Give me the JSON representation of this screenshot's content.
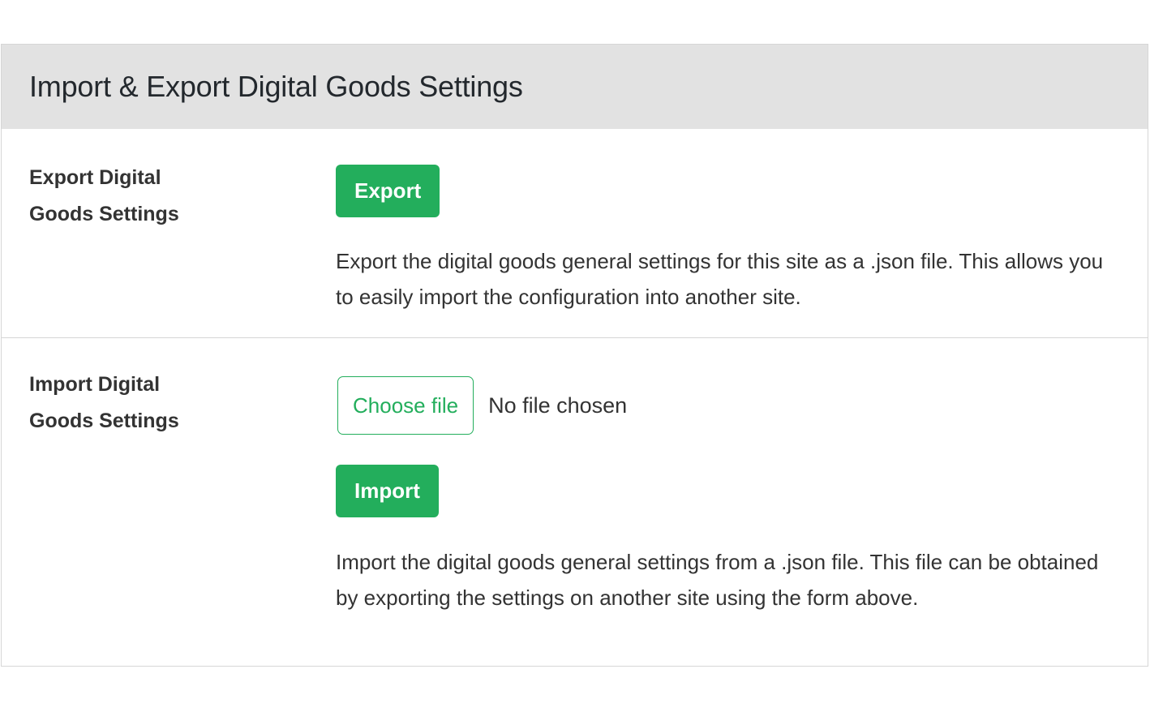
{
  "panel": {
    "title": "Import & Export Digital Goods Settings"
  },
  "export_section": {
    "label": "Export Digital Goods Settings",
    "button_label": "Export",
    "description": "Export the digital goods general settings for this site as a .json file. This allows you to easily import the configuration into another site."
  },
  "import_section": {
    "label": "Import Digital Goods Settings",
    "choose_file_label": "Choose file",
    "file_status": "No file chosen",
    "button_label": "Import",
    "description": "Import the digital goods general settings from a .json file. This file can be obtained by exporting the settings on another site using the form above."
  },
  "colors": {
    "accent": "#23ae5c",
    "header_bg": "#e2e2e2",
    "border": "#d6d6d6",
    "text": "#333333"
  }
}
